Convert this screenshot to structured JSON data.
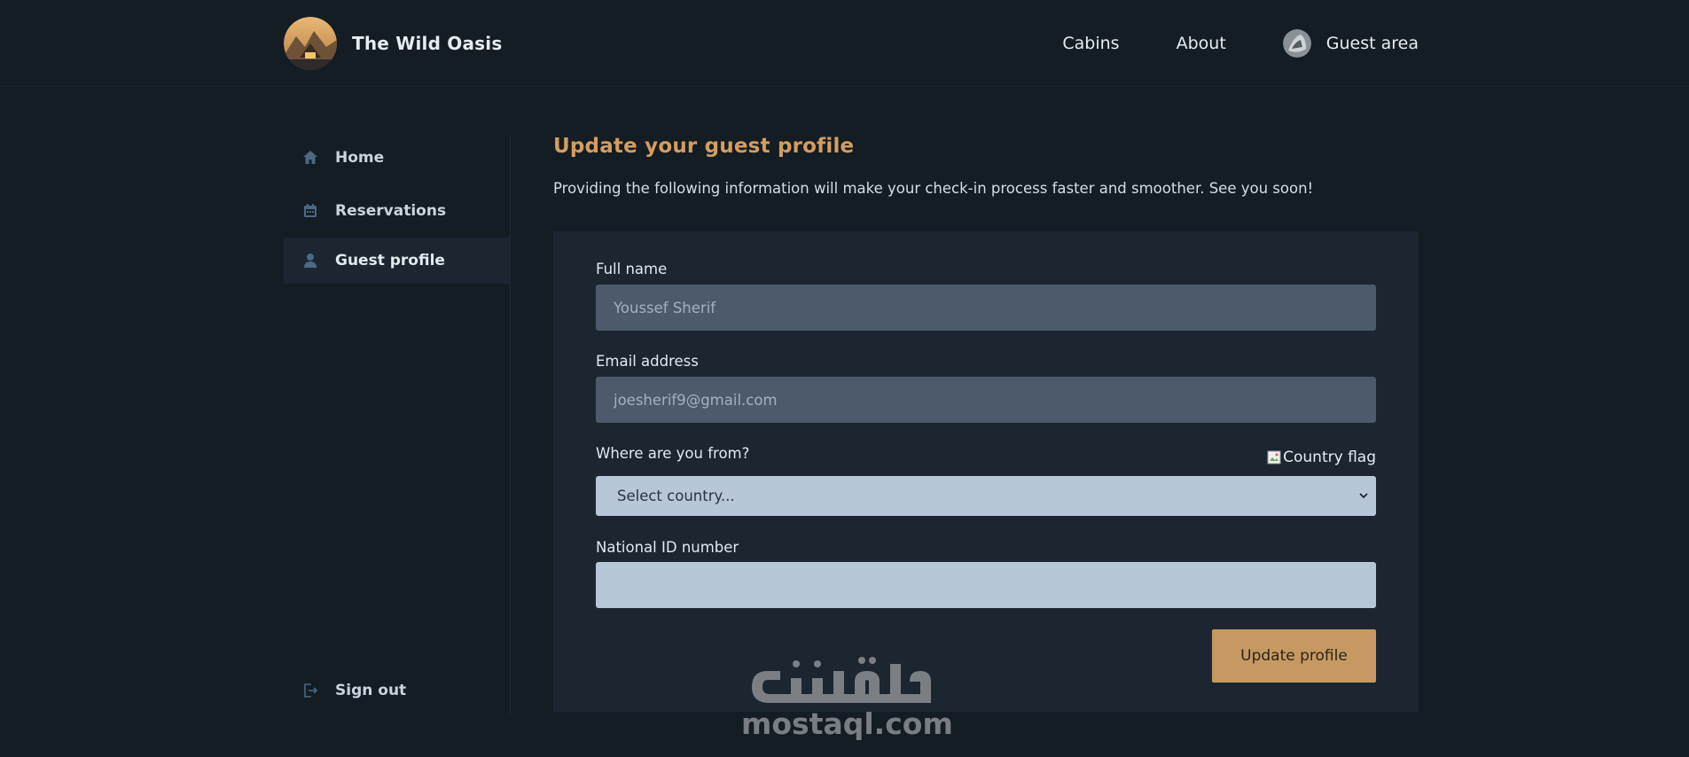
{
  "header": {
    "brand_name": "The Wild Oasis",
    "nav": {
      "cabins": "Cabins",
      "about": "About",
      "guest_area": "Guest area"
    }
  },
  "sidebar": {
    "items": [
      {
        "label": "Home",
        "icon": "home-icon"
      },
      {
        "label": "Reservations",
        "icon": "calendar-icon"
      },
      {
        "label": "Guest profile",
        "icon": "user-icon",
        "active": true
      }
    ],
    "sign_out": {
      "label": "Sign out",
      "icon": "sign-out-icon"
    }
  },
  "main": {
    "title": "Update your guest profile",
    "subtitle": "Providing the following information will make your check-in process faster and smoother. See you soon!",
    "form": {
      "full_name_label": "Full name",
      "full_name_value": "Youssef Sherif",
      "email_label": "Email address",
      "email_value": "joesherif9@gmail.com",
      "country_label": "Where are you from?",
      "country_flag_alt": "Country flag",
      "country_select_value": "Select country...",
      "national_id_label": "National ID number",
      "national_id_value": "",
      "submit_label": "Update profile"
    }
  },
  "watermark": {
    "text": "mostaql.com"
  },
  "colors": {
    "background": "#141c24",
    "card": "#1b2631",
    "accent": "#c69963",
    "title": "#d49d5d",
    "disabled_input": "#4c5a6b",
    "light_input": "#b7c7d8"
  }
}
